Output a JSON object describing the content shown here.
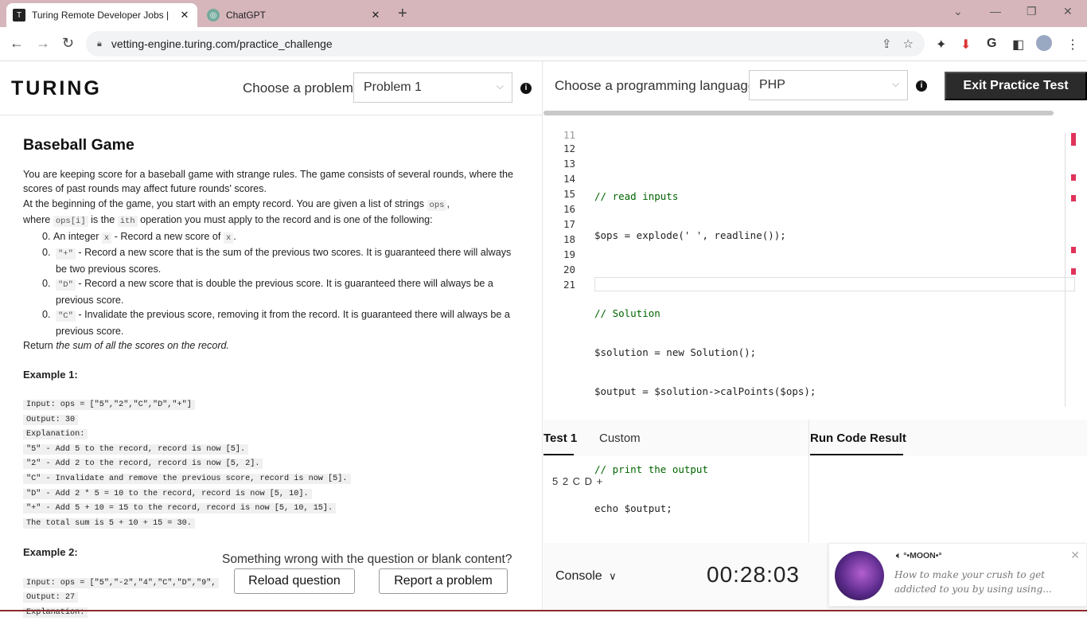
{
  "browser": {
    "tabs": [
      {
        "title": "Turing Remote Developer Jobs | ",
        "favicon": "turing-favicon",
        "active": true
      },
      {
        "title": "ChatGPT",
        "favicon": "chatgpt-favicon",
        "active": false
      }
    ],
    "url": "vetting-engine.turing.com/practice_challenge"
  },
  "header": {
    "logo": "TURING",
    "problem_label": "Choose a problem",
    "problem_value": "Problem 1",
    "language_label": "Choose a programming language",
    "language_value": "PHP",
    "exit_button": "Exit Practice Test"
  },
  "problem": {
    "title": "Baseball Game",
    "intro1": "You are keeping score for a baseball game with strange rules. The game consists of several rounds, where the scores of past rounds may affect future rounds' scores.",
    "intro2a": "At the beginning of the game, you start with an empty record. You are given a list of strings",
    "intro2_code": "ops",
    "intro2b": ",",
    "intro3a": "where",
    "intro3_code1": "ops[i]",
    "intro3b": "is the",
    "intro3_code2": "ith",
    "intro3c": "operation you must apply to the record and is one of the following:",
    "ops": [
      {
        "num": "0.",
        "pre": "An integer",
        "code": "x",
        "post": "- Record a new score of",
        "code2": "x",
        "tail": "."
      },
      {
        "num": "0.",
        "pre": "",
        "code": "\"+\"",
        "post": "- Record a new score that is the sum of the previous two scores. It is guaranteed there will always be two previous scores.",
        "code2": "",
        "tail": ""
      },
      {
        "num": "0.",
        "pre": "",
        "code": "\"D\"",
        "post": "- Record a new score that is double the previous score. It is guaranteed there will always be a previous score.",
        "code2": "",
        "tail": ""
      },
      {
        "num": "0.",
        "pre": "",
        "code": "\"C\"",
        "post": "- Invalidate the previous score, removing it from the record. It is guaranteed there will always be a previous score.",
        "code2": "",
        "tail": ""
      }
    ],
    "return_a": "Return",
    "return_b": "the sum of all the scores on the record.",
    "example1_title": "Example 1:",
    "example1_lines": [
      "Input: ops = [\"5\",\"2\",\"C\",\"D\",\"+\"]",
      "Output: 30",
      "Explanation:",
      "\"5\" - Add 5 to the record, record is now [5].",
      "\"2\" - Add 2 to the record, record is now [5, 2].",
      "\"C\" - Invalidate and remove the previous score, record is now [5].",
      "\"D\" - Add 2 * 5 = 10 to the record, record is now [5, 10].",
      "\"+\" - Add 5 + 10 = 15 to the record, record is now [5, 10, 15].",
      "The total sum is 5 + 10 + 15 = 30."
    ],
    "example2_title": "Example 2:",
    "example2_lines": [
      "Input: ops = [\"5\",\"-2\",\"4\",\"C\",\"D\",\"9\",",
      "Output: 27",
      "Explanation:"
    ],
    "footer_prompt": "Something wrong with the question or blank content?",
    "reload_button": "Reload question",
    "report_button": "Report a problem"
  },
  "editor": {
    "lines": [
      {
        "n": "11",
        "text": "",
        "cls": ""
      },
      {
        "n": "12",
        "text": "// read inputs",
        "cls": "cm"
      },
      {
        "n": "13",
        "text": "$ops = explode(' ', readline());",
        "cls": ""
      },
      {
        "n": "14",
        "text": "",
        "cls": ""
      },
      {
        "n": "15",
        "text": "// Solution",
        "cls": "cm"
      },
      {
        "n": "16",
        "text": "$solution = new Solution();",
        "cls": ""
      },
      {
        "n": "17",
        "text": "$output = $solution->calPoints($ops);",
        "cls": ""
      },
      {
        "n": "18",
        "text": "",
        "cls": ""
      },
      {
        "n": "19",
        "text": "// print the output",
        "cls": "cm"
      },
      {
        "n": "20",
        "text": "echo $output;",
        "cls": ""
      },
      {
        "n": "21",
        "text": "",
        "cls": ""
      }
    ]
  },
  "tests": {
    "tab1": "Test 1",
    "tab2": "Custom",
    "result_tab": "Run Code Result",
    "test_input": "5 2 C D +"
  },
  "console": {
    "label": "Console",
    "timer": "00:28:03"
  },
  "notification": {
    "title": "°•MOON•°",
    "body": "How to make your crush to get addicted to you by using using..."
  }
}
